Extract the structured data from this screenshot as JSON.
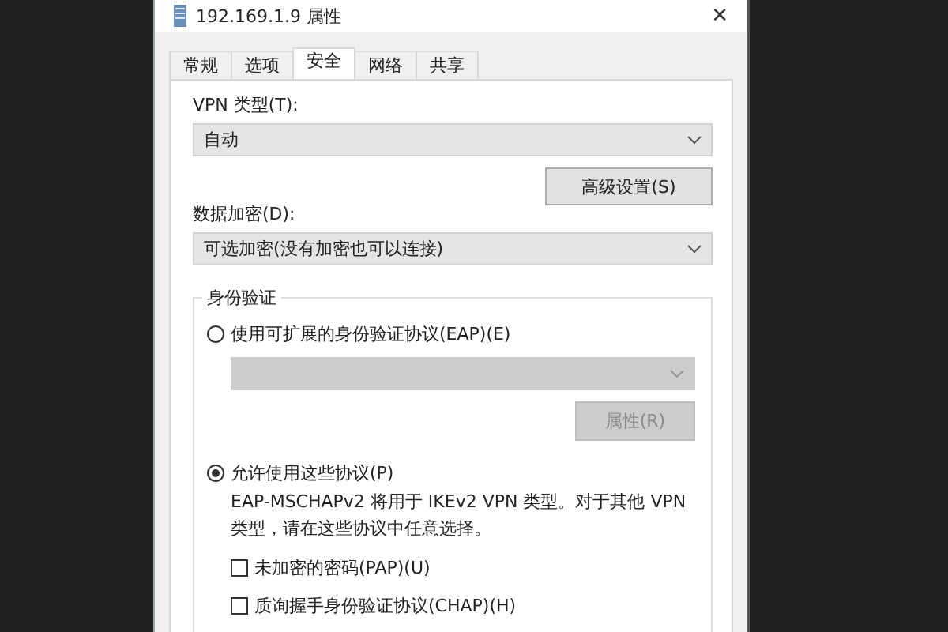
{
  "window": {
    "title": "192.169.1.9 属性",
    "close": "✕"
  },
  "tabs": [
    {
      "label": "常规",
      "selected": false
    },
    {
      "label": "选项",
      "selected": false
    },
    {
      "label": "安全",
      "selected": true
    },
    {
      "label": "网络",
      "selected": false
    },
    {
      "label": "共享",
      "selected": false
    }
  ],
  "vpn_type": {
    "label": "VPN 类型(T):",
    "value": "自动"
  },
  "advanced_button": "高级设置(S)",
  "encryption": {
    "label": "数据加密(D):",
    "value": "可选加密(没有加密也可以连接)"
  },
  "authentication": {
    "title": "身份验证",
    "eap": {
      "label": "使用可扩展的身份验证协议(EAP)(E)",
      "selected": false,
      "properties_button": "属性(R)",
      "disabled": true
    },
    "allow": {
      "label": "允许使用这些协议(P)",
      "selected": true,
      "description": "EAP-MSCHAPv2 将用于 IKEv2 VPN 类型。对于其他 VPN 类型，请在这些协议中任意选择。"
    },
    "protocols": [
      {
        "label": "未加密的密码(PAP)(U)",
        "checked": false
      },
      {
        "label": "质询握手身份验证协议(CHAP)(H)",
        "checked": false
      }
    ]
  }
}
